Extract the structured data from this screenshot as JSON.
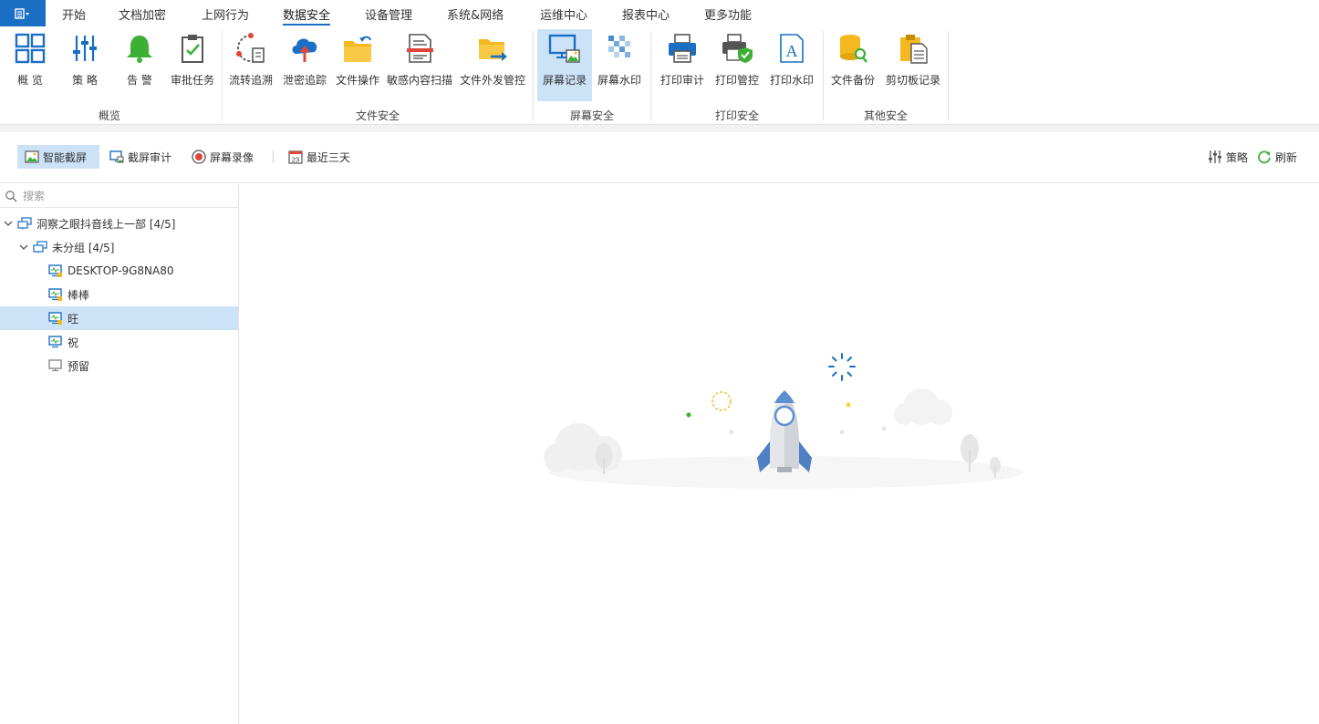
{
  "menubar": {
    "app_menu_icon": "app-menu-icon",
    "tabs": [
      {
        "label": "开始"
      },
      {
        "label": "文档加密"
      },
      {
        "label": "上网行为"
      },
      {
        "label": "数据安全"
      },
      {
        "label": "设备管理"
      },
      {
        "label": "系统&网络"
      },
      {
        "label": "运维中心"
      },
      {
        "label": "报表中心"
      },
      {
        "label": "更多功能"
      }
    ],
    "active_tab": "数据安全"
  },
  "ribbon": {
    "groups": [
      {
        "label": "概览",
        "buttons": [
          {
            "label": "概 览",
            "icon": "overview-grid-icon"
          },
          {
            "label": "策 略",
            "icon": "policy-sliders-icon"
          },
          {
            "label": "告 警",
            "icon": "alarm-bell-icon"
          },
          {
            "label": "审批任务",
            "icon": "approval-clipboard-icon"
          }
        ]
      },
      {
        "label": "文件安全",
        "buttons": [
          {
            "label": "流转追溯",
            "icon": "trace-flow-icon"
          },
          {
            "label": "泄密追踪",
            "icon": "cloud-upload-icon"
          },
          {
            "label": "文件操作",
            "icon": "folder-operation-icon"
          },
          {
            "label": "敏感内容扫描",
            "icon": "document-scan-icon"
          },
          {
            "label": "文件外发管控",
            "icon": "folder-send-icon"
          }
        ]
      },
      {
        "label": "屏幕安全",
        "buttons": [
          {
            "label": "屏幕记录",
            "icon": "screen-record-icon"
          },
          {
            "label": "屏幕水印",
            "icon": "screen-watermark-icon"
          }
        ]
      },
      {
        "label": "打印安全",
        "buttons": [
          {
            "label": "打印审计",
            "icon": "printer-icon"
          },
          {
            "label": "打印管控",
            "icon": "printer-shield-icon"
          },
          {
            "label": "打印水印",
            "icon": "print-watermark-icon"
          }
        ]
      },
      {
        "label": "其他安全",
        "buttons": [
          {
            "label": "文件备份",
            "icon": "database-backup-icon"
          },
          {
            "label": "剪切板记录",
            "icon": "clipboard-record-icon"
          }
        ]
      }
    ],
    "active_button": "屏幕记录"
  },
  "toolbar": {
    "smart_capture": "智能截屏",
    "capture_audit": "截屏审计",
    "screen_video": "屏幕录像",
    "date_range": "最近三天",
    "date_icon_day": "23",
    "policy": "策略",
    "refresh": "刷新"
  },
  "tree": {
    "search_placeholder": "搜索",
    "root": {
      "label": "洞察之眼抖音线上一部 [4/5]"
    },
    "group": {
      "label": "未分组 [4/5]"
    },
    "computers": [
      {
        "label": "DESKTOP-9G8NA80",
        "status": "online-locked"
      },
      {
        "label": "棒棒",
        "status": "online-locked"
      },
      {
        "label": "旺",
        "status": "online-locked"
      },
      {
        "label": "祝",
        "status": "online"
      },
      {
        "label": "预留",
        "status": "offline"
      }
    ],
    "selected": "旺"
  },
  "colors": {
    "accent": "#1a6fc4",
    "selection": "#cce3f7",
    "bell_green": "#3cb035",
    "folder_yellow": "#f5b820",
    "alert_red": "#e0453a"
  }
}
